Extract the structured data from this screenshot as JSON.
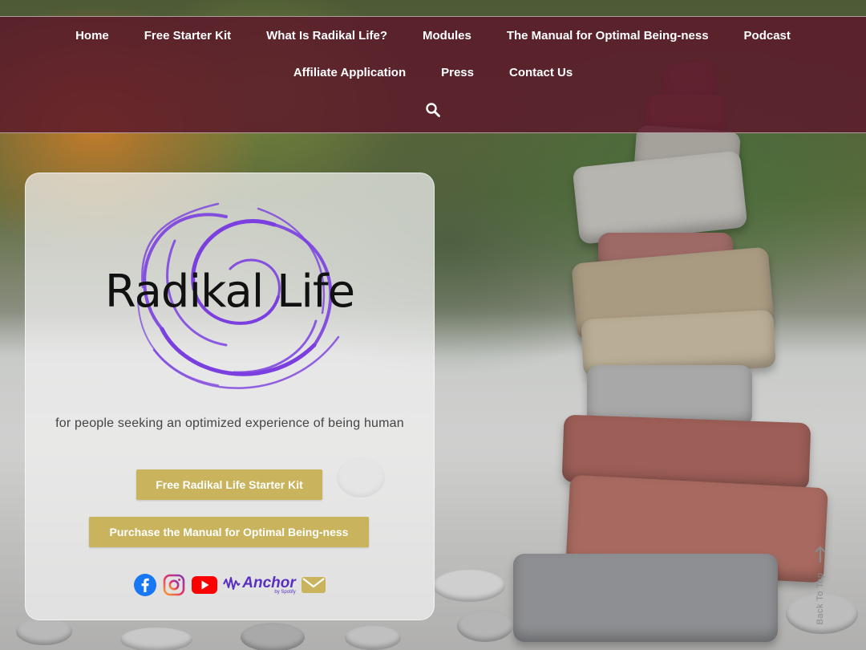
{
  "nav": {
    "row1": [
      "Home",
      "Free Starter Kit",
      "What Is Radikal Life?",
      "Modules",
      "The Manual for Optimal Being-ness",
      "Podcast"
    ],
    "row2": [
      "Affiliate Application",
      "Press",
      "Contact Us"
    ],
    "search_icon": "search-icon"
  },
  "hero": {
    "logo_text": "Radikal Life",
    "tagline": "for people seeking an optimized experience of being human",
    "button_starter": "Free Radikal Life Starter Kit",
    "button_manual": "Purchase the Manual for Optimal Being-ness",
    "social": {
      "icons": [
        "facebook-icon",
        "instagram-icon",
        "youtube-icon",
        "anchor-icon",
        "email-icon"
      ],
      "anchor_label": "Anchor",
      "anchor_sub": "by Spotify"
    }
  },
  "back_to_top": "Back To Top",
  "colors": {
    "nav_bg": "#5c1a2a",
    "button_gold": "#c9b35d",
    "logo_purple": "#7b3fe0"
  }
}
